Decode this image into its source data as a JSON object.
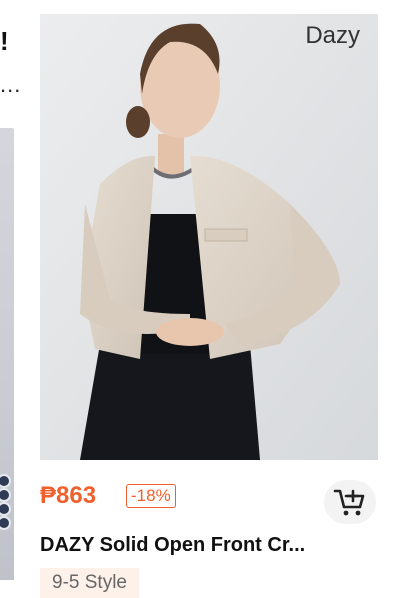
{
  "left_card": {
    "title_fragment": "!",
    "ellipsis": "..."
  },
  "product": {
    "brand_watermark": "Dazy",
    "price": "₱863",
    "discount": "-18%",
    "title": "DAZY Solid Open Front Cr...",
    "tag": "9-5 Style",
    "image_desc_icon": "model-photo",
    "cart_icon": "add-to-cart-icon"
  },
  "colors": {
    "price": "#f0602c",
    "tag_bg": "#fdf1ea",
    "cart_bg": "#f3f3f3"
  }
}
